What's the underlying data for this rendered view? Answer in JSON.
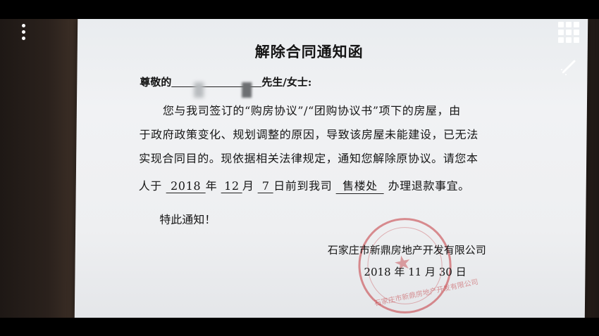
{
  "document": {
    "title": "解除合同通知函",
    "salutation_prefix": "尊敬的",
    "salutation_suffix": "先生/女士:",
    "line1": "您与我司签订的“购房协议”/“团购协议书”项下的房屋，由",
    "line2": "于政府政策变化、规划调整的原因，导致该房屋未能建设，已无法",
    "line3": "实现合同目的。现依据相关法律规定，通知您解除原协议。请您本",
    "line4_prefix": "人于",
    "year": "2018",
    "year_unit": "年",
    "month": "12",
    "month_unit": "月",
    "day": "7",
    "line4_mid": "日前到我司",
    "place": "售楼处",
    "line4_suffix": "办理退款事宜。",
    "notice": "特此通知！",
    "company": "石家庄市新鼎房地产开发有限公司",
    "sign_date": "2018 年  11  月 30 日",
    "stamp_text": "石家庄市新鼎房地产开发有限公司"
  },
  "icons": {
    "menu": "more-vertical-icon",
    "grid": "grid-icon",
    "edit": "pen-icon"
  },
  "colors": {
    "stamp": "#c4373c",
    "paper": "#eeeff1"
  }
}
